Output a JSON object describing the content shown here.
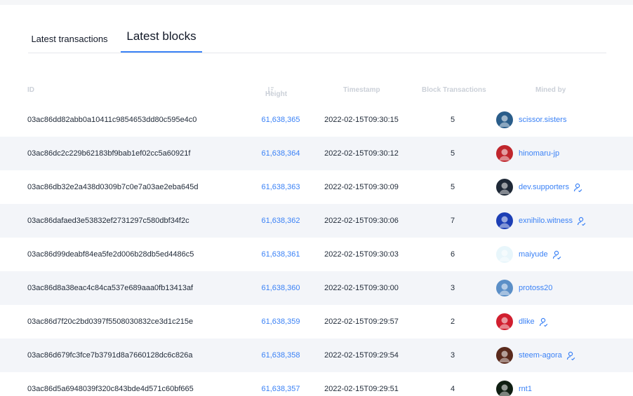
{
  "tabs": {
    "latest_transactions": "Latest transactions",
    "latest_blocks": "Latest blocks"
  },
  "columns": {
    "id": "ID",
    "height": "Height",
    "timestamp": "Timestamp",
    "block_transactions": "Block Transactions",
    "mined_by": "Mined by"
  },
  "sort_icon": "sort-icon",
  "colors": {
    "accent": "#3b82f6",
    "header_text": "#cbd0d8",
    "stripe": "#f3f5f9"
  },
  "blocks": [
    {
      "id": "03ac86dd82abb0a10411c9854653dd80c595e4c0",
      "height": "61,638,365",
      "timestamp": "2022-02-15T09:30:15",
      "txs": "5",
      "miner": "scissor.sisters",
      "witness": false,
      "avatar_color": "#2a5d8a"
    },
    {
      "id": "03ac86dc2c229b62183bf9bab1ef02cc5a60921f",
      "height": "61,638,364",
      "timestamp": "2022-02-15T09:30:12",
      "txs": "5",
      "miner": "hinomaru-jp",
      "witness": false,
      "avatar_color": "#c0262d"
    },
    {
      "id": "03ac86db32e2a438d0309b7c0e7a03ae2eba645d",
      "height": "61,638,363",
      "timestamp": "2022-02-15T09:30:09",
      "txs": "5",
      "miner": "dev.supporters",
      "witness": true,
      "avatar_color": "#1f2937"
    },
    {
      "id": "03ac86dafaed3e53832ef2731297c580dbf34f2c",
      "height": "61,638,362",
      "timestamp": "2022-02-15T09:30:06",
      "txs": "7",
      "miner": "exnihilo.witness",
      "witness": true,
      "avatar_color": "#1d3fb5"
    },
    {
      "id": "03ac86d99deabf84ea5fe2d006b28db5ed4486c5",
      "height": "61,638,361",
      "timestamp": "2022-02-15T09:30:03",
      "txs": "6",
      "miner": "maiyude",
      "witness": true,
      "avatar_color": "#e8f6fb"
    },
    {
      "id": "03ac86d8a38eac4c84ca537e689aaa0fb13413af",
      "height": "61,638,360",
      "timestamp": "2022-02-15T09:30:00",
      "txs": "3",
      "miner": "protoss20",
      "witness": false,
      "avatar_color": "#5b8fc7"
    },
    {
      "id": "03ac86d7f20c2bd0397f5508030832ce3d1c215e",
      "height": "61,638,359",
      "timestamp": "2022-02-15T09:29:57",
      "txs": "2",
      "miner": "dlike",
      "witness": true,
      "avatar_color": "#d11f2f"
    },
    {
      "id": "03ac86d679fc3fce7b3791d8a7660128dc6c826a",
      "height": "61,638,358",
      "timestamp": "2022-02-15T09:29:54",
      "txs": "3",
      "miner": "steem-agora",
      "witness": true,
      "avatar_color": "#5a2a1c"
    },
    {
      "id": "03ac86d5a6948039f320c843bde4d571c60bf665",
      "height": "61,638,357",
      "timestamp": "2022-02-15T09:29:51",
      "txs": "4",
      "miner": "rnt1",
      "witness": false,
      "avatar_color": "#0f1e12"
    }
  ]
}
